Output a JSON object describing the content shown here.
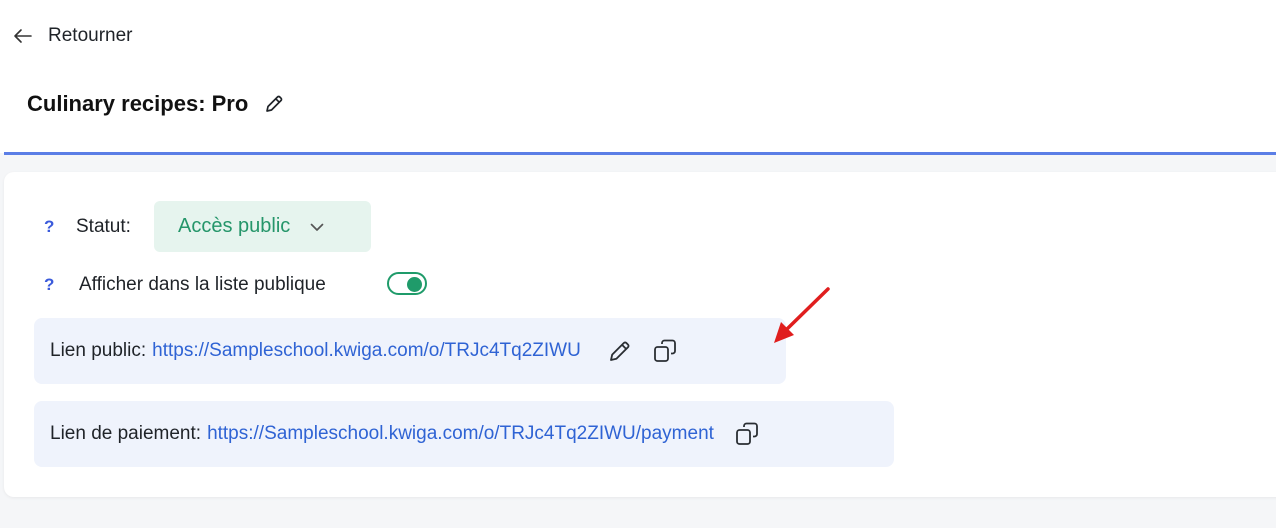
{
  "nav": {
    "back_label": "Retourner"
  },
  "page": {
    "title": "Culinary recipes: Pro"
  },
  "settings": {
    "status": {
      "help": "?",
      "label": "Statut:",
      "value": "Accès public"
    },
    "public_list": {
      "help": "?",
      "label": "Afficher dans la liste publique",
      "enabled": true
    }
  },
  "links": {
    "public": {
      "label": "Lien public:",
      "url": "https://Sampleschool.kwiga.com/o/TRJc4Tq2ZIWU"
    },
    "payment": {
      "label": "Lien de paiement:",
      "url": "https://Sampleschool.kwiga.com/o/TRJc4Tq2ZIWU/payment"
    }
  },
  "colors": {
    "accent_blue": "#2f63d4",
    "header_line": "#5b7ee6",
    "status_green": "#25966a",
    "status_bg": "#e6f4ee",
    "toggle_green": "#1f9b6a",
    "link_box_bg": "#eff3fc",
    "annotation_red": "#e01e1e"
  },
  "icons": {
    "back": "arrow-left-icon",
    "title_edit": "pencil-icon",
    "status_dropdown": "chevron-down-icon",
    "public_edit": "pencil-icon",
    "copy": "copy-icon",
    "annotation": "red-arrow-annotation"
  }
}
